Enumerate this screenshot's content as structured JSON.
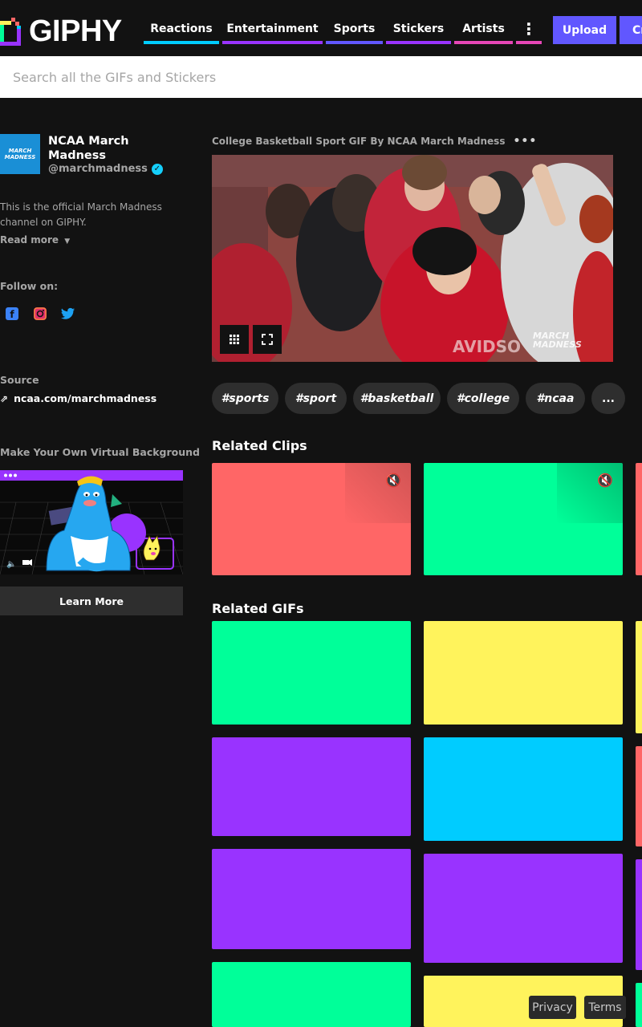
{
  "header": {
    "brand": "GIPHY",
    "nav": [
      {
        "label": "Reactions",
        "color": "#00ccff"
      },
      {
        "label": "Entertainment",
        "color": "#9933ff"
      },
      {
        "label": "Sports",
        "color": "#6157ff"
      },
      {
        "label": "Stickers",
        "color": "#9933ff"
      },
      {
        "label": "Artists",
        "color": "#e646b6"
      }
    ],
    "more_color": "#e646b6",
    "upload_label": "Upload",
    "create_label": "Cr"
  },
  "search": {
    "placeholder": "Search all the GIFs and Stickers"
  },
  "channel": {
    "name_line1": "NCAA March",
    "name_line2": "Madness",
    "handle": "@marchmadness",
    "avatar_text": "MARCH MADNESS",
    "desc_line1": "This is the official March Madness",
    "desc_line2": "channel on GIPHY.",
    "read_more": "Read more",
    "follow_on": "Follow on:",
    "source_heading": "Source",
    "source_link": "ncaa.com/marchmadness"
  },
  "promo": {
    "heading": "Make Your Own Virtual Background",
    "button": "Learn More"
  },
  "gif": {
    "title": "College Basketball Sport GIF By NCAA March Madness",
    "watermark_line1": "MARCH",
    "watermark_line2": "MADNESS"
  },
  "tags": [
    "#sports",
    "#sport",
    "#basketball",
    "#college",
    "#ncaa",
    "..."
  ],
  "related_clips": {
    "heading": "Related Clips",
    "colors": [
      "#ff6666",
      "#00ff99",
      "#ff6666"
    ]
  },
  "related_gifs": {
    "heading": "Related GIFs",
    "colors": [
      "#00ff99",
      "#fff35c",
      "#fff35c",
      "#9933ff",
      "#00ccff",
      "#ff6666",
      "#9933ff",
      "#9933ff",
      "#9933ff",
      "#00ff99",
      "#fff35c",
      "#00ff99"
    ]
  },
  "footer": {
    "privacy": "Privacy",
    "terms": "Terms"
  }
}
